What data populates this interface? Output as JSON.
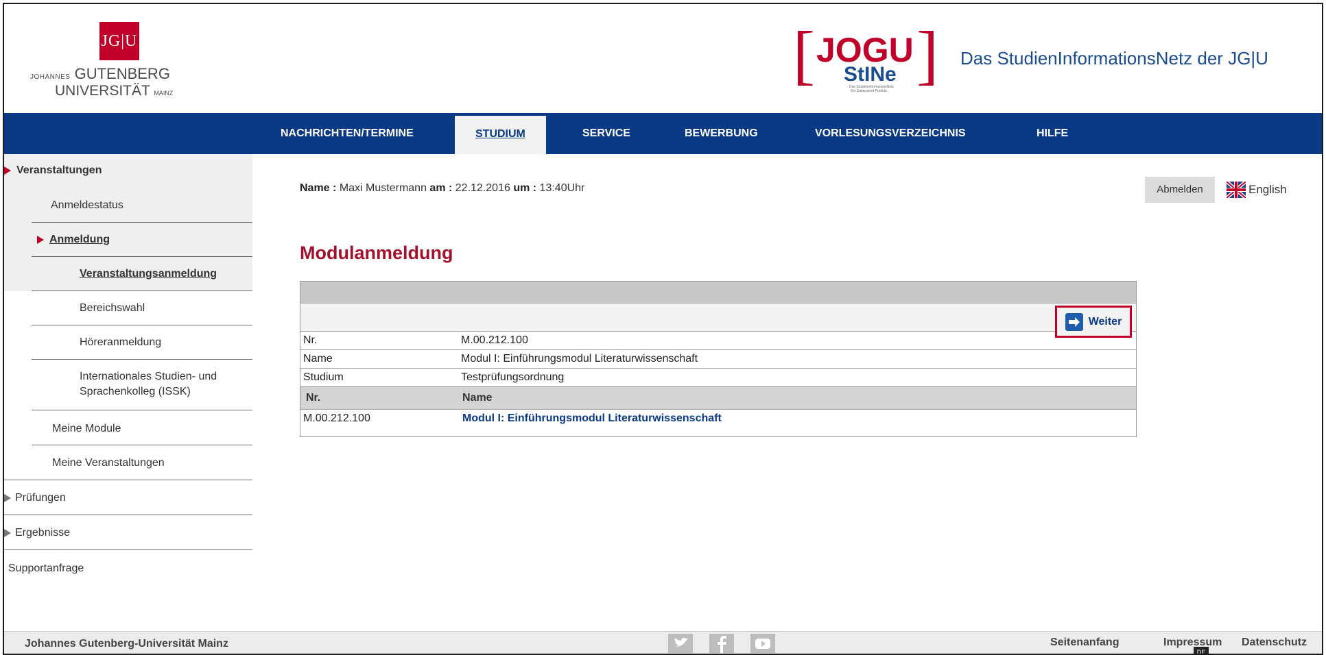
{
  "header": {
    "university": {
      "line1_small": "JOHANNES",
      "line1": "GUTENBERG",
      "line2": "UNIVERSITÄT",
      "line2_small": "MAINZ",
      "badge": "JG|U"
    },
    "stine": {
      "brand": "JOGU",
      "sub": "StINe",
      "tagline1": "Das StudienInformationsNetz",
      "tagline2": "Ein Campusnet Produkt"
    },
    "site_title": "Das StudienInformationsNetz der JG|U"
  },
  "nav": {
    "items": [
      "NACHRICHTEN/TERMINE",
      "STUDIUM",
      "SERVICE",
      "BEWERBUNG",
      "VORLESUNGSVERZEICHNIS",
      "HILFE"
    ],
    "active": "STUDIUM"
  },
  "sidebar": {
    "veranstaltungen": "Veranstaltungen",
    "anmeldestatus": "Anmeldestatus",
    "anmeldung": "Anmeldung",
    "veranstaltungsanmeldung": "Veranstaltungsanmeldung",
    "bereichswahl": "Bereichswahl",
    "hoereranmeldung": "Höreranmeldung",
    "issk_line1": "Internationales Studien- und",
    "issk_line2": "Sprachenkolleg (ISSK)",
    "meine_module": "Meine Module",
    "meine_veranstaltungen": "Meine Veranstaltungen",
    "pruefungen": "Prüfungen",
    "ergebnisse": "Ergebnisse",
    "supportanfrage": "Supportanfrage"
  },
  "user": {
    "name_label": "Name :",
    "name": "Maxi Mustermann",
    "date_label": "am :",
    "date": "22.12.2016",
    "time_label": "um :",
    "time": "13:40Uhr"
  },
  "actions": {
    "logout": "Abmelden",
    "language": "English"
  },
  "page_title": "Modulanmeldung",
  "module": {
    "weiter": "Weiter",
    "details": [
      {
        "label": "Nr.",
        "value": "M.00.212.100"
      },
      {
        "label": "Name",
        "value": "Modul I: Einführungsmodul Literaturwissenschaft"
      },
      {
        "label": "Studium",
        "value": "Testprüfungsordnung"
      }
    ],
    "list_headers": [
      "Nr.",
      "Name"
    ],
    "list_rows": [
      {
        "nr": "M.00.212.100",
        "name": "Modul I: Einführungsmodul Literaturwissenschaft"
      }
    ]
  },
  "footer": {
    "left": "Johannes Gutenberg-Universität Mainz",
    "seitenanfang": "Seitenanfang",
    "impressum": "Impressum",
    "datenschutz": "Datenschutz",
    "lang_badge": "DE"
  }
}
